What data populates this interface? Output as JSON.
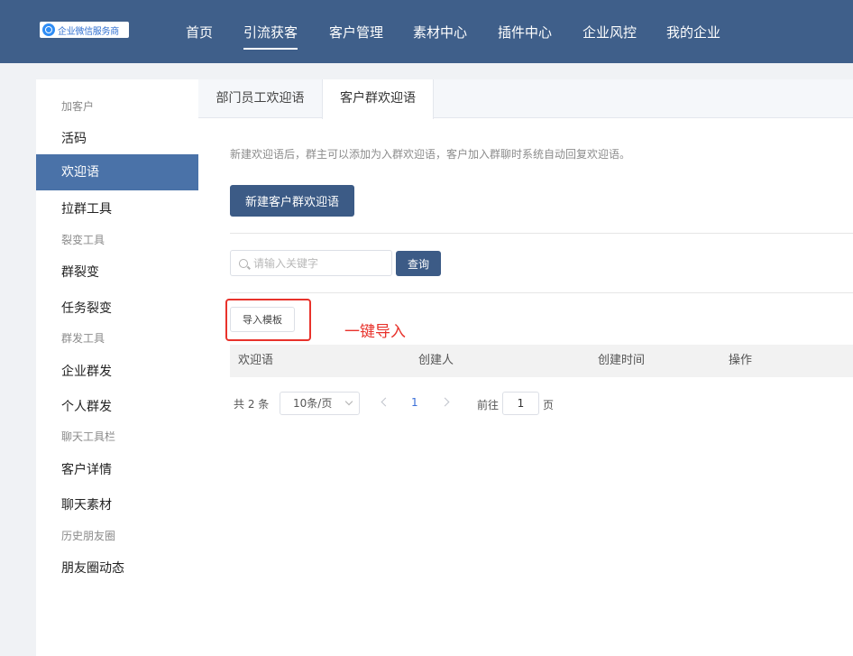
{
  "logo": {
    "text": "企业微信服务商"
  },
  "nav": {
    "items": [
      "首页",
      "引流获客",
      "客户管理",
      "素材中心",
      "插件中心",
      "企业风控",
      "我的企业"
    ],
    "active_index": 1
  },
  "sidebar": {
    "items": [
      {
        "type": "group",
        "label": "加客户"
      },
      {
        "type": "link",
        "label": "活码"
      },
      {
        "type": "link",
        "label": "欢迎语",
        "active": true
      },
      {
        "type": "link",
        "label": "拉群工具"
      },
      {
        "type": "group",
        "label": "裂变工具"
      },
      {
        "type": "link",
        "label": "群裂变"
      },
      {
        "type": "link",
        "label": "任务裂变"
      },
      {
        "type": "group",
        "label": "群发工具"
      },
      {
        "type": "link",
        "label": "企业群发"
      },
      {
        "type": "link",
        "label": "个人群发"
      },
      {
        "type": "group",
        "label": "聊天工具栏"
      },
      {
        "type": "link",
        "label": "客户详情"
      },
      {
        "type": "link",
        "label": "聊天素材"
      },
      {
        "type": "group",
        "label": "历史朋友圈"
      },
      {
        "type": "link",
        "label": "朋友圈动态"
      }
    ]
  },
  "tabs": [
    "部门员工欢迎语",
    "客户群欢迎语"
  ],
  "active_tab": 1,
  "main": {
    "description": "新建欢迎语后，群主可以添加为入群欢迎语，客户加入群聊时系统自动回复欢迎语。",
    "new_button": "新建客户群欢迎语",
    "search_placeholder": "请输入关键字",
    "query_button": "查询",
    "import_button": "导入模板",
    "annotation": "一键导入"
  },
  "table": {
    "columns": [
      "欢迎语",
      "创建人",
      "创建时间",
      "操作"
    ],
    "rows": []
  },
  "pagination": {
    "total": "共 2 条",
    "page_size": "10条/页",
    "current_page": "1",
    "goto_label": "前往",
    "goto_value": "1",
    "goto_unit": "页"
  },
  "colors": {
    "header_bg": "#3f5f8a",
    "primary": "#3c5b86",
    "sidebar_active": "#4a72a8",
    "annotation": "#e8322b"
  }
}
